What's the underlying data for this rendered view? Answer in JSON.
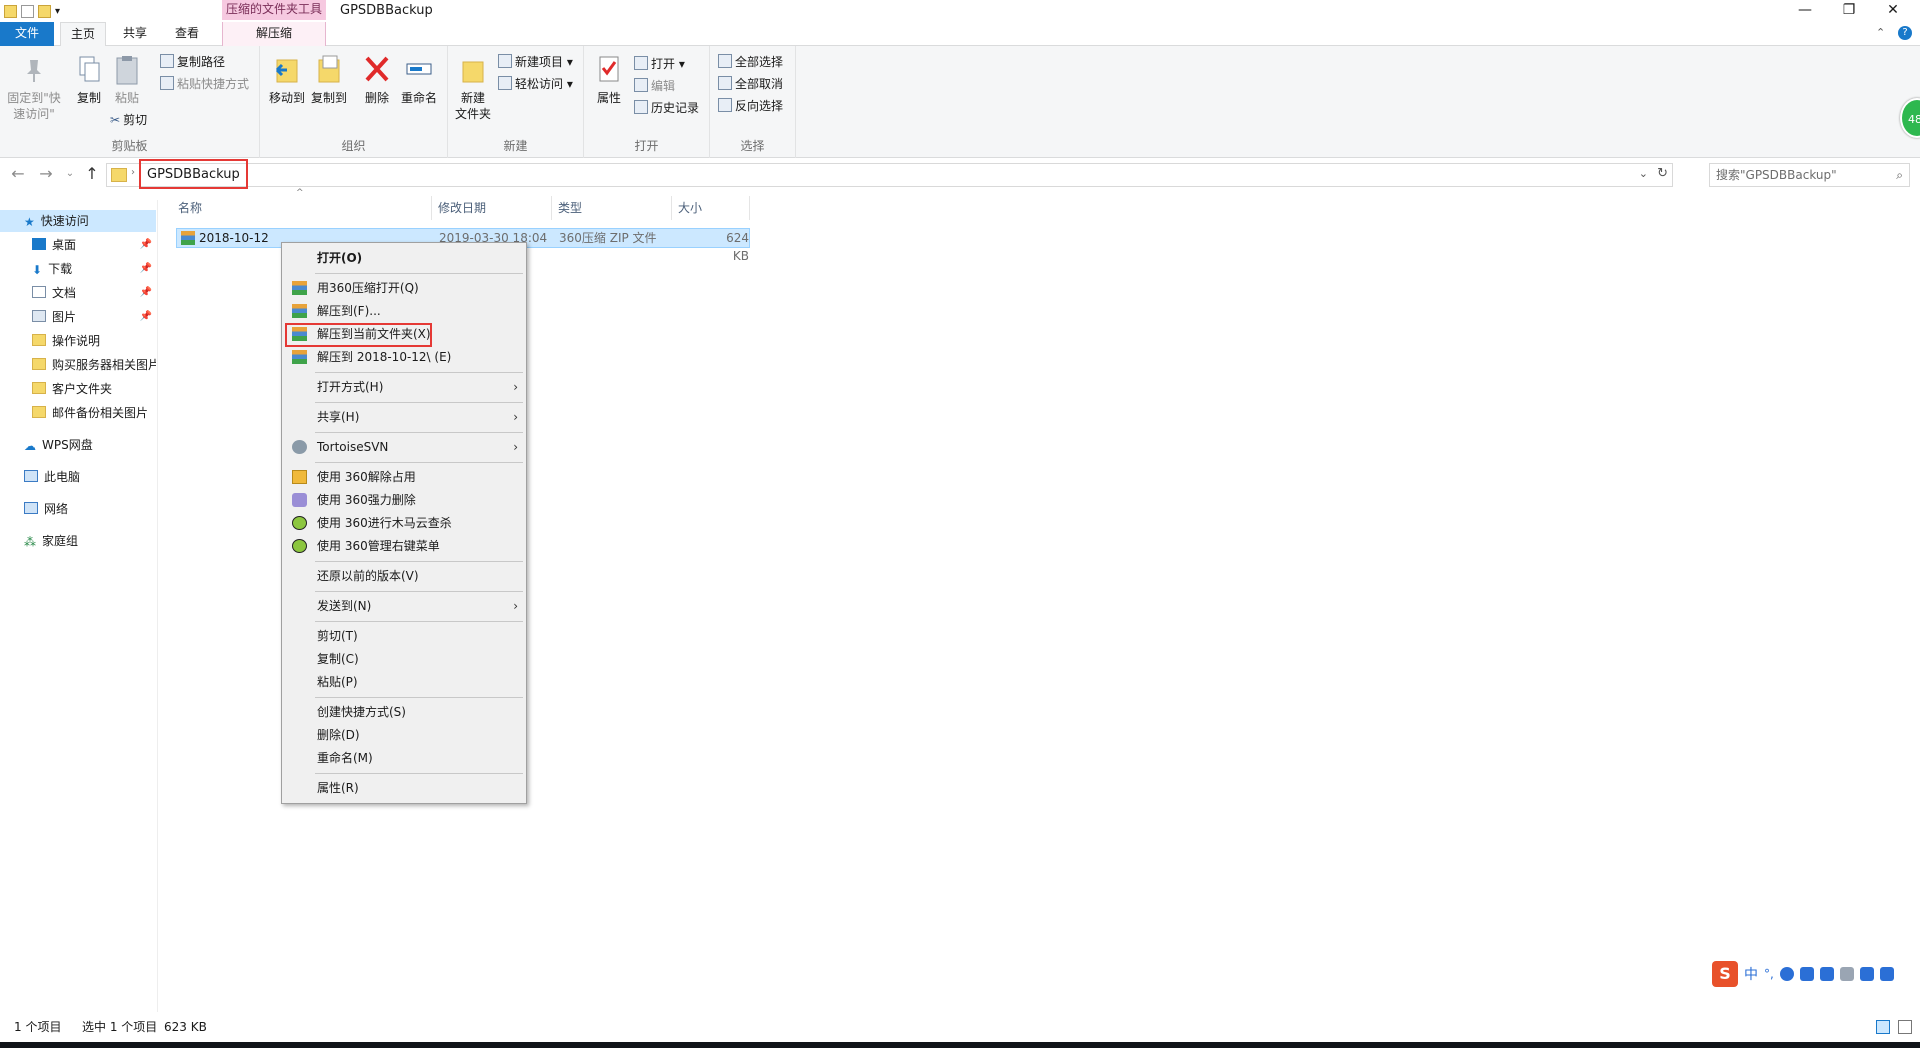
{
  "window": {
    "title": "GPSDBBackup",
    "context_tab_group": "压缩的文件夹工具",
    "controls": {
      "minimize": "—",
      "restore": "❐",
      "close": "✕"
    }
  },
  "tabs": {
    "file": "文件",
    "home": "主页",
    "share": "共享",
    "view": "查看",
    "unzip": "解压缩"
  },
  "ribbon": {
    "clipboard": {
      "label": "剪贴板",
      "pin": "固定到\"快速访问\"",
      "copy": "复制",
      "paste": "粘贴",
      "copy_path": "复制路径",
      "paste_shortcut": "粘贴快捷方式",
      "cut": "剪切"
    },
    "organize": {
      "label": "组织",
      "move_to": "移动到",
      "copy_to": "复制到",
      "delete": "删除",
      "rename": "重命名"
    },
    "new": {
      "label": "新建",
      "new_item": "新建项目 ▾",
      "easy_access": "轻松访问 ▾",
      "new_folder": "新建\n文件夹"
    },
    "open": {
      "label": "打开",
      "properties": "属性",
      "open": "打开 ▾",
      "edit": "编辑",
      "history": "历史记录"
    },
    "select": {
      "label": "选择",
      "select_all": "全部选择",
      "select_none": "全部取消",
      "invert": "反向选择"
    }
  },
  "address": {
    "crumb": "GPSDBBackup",
    "search_placeholder": "搜索\"GPSDBBackup\""
  },
  "navpane": {
    "quick_access": "快速访问",
    "items": [
      "桌面",
      "下载",
      "文档",
      "图片",
      "操作说明",
      "购买服务器相关图片",
      "客户文件夹",
      "邮件备份相关图片"
    ],
    "wps": "WPS网盘",
    "this_pc": "此电脑",
    "network": "网络",
    "homegroup": "家庭组"
  },
  "columns": {
    "name": "名称",
    "modified": "修改日期",
    "type": "类型",
    "size": "大小"
  },
  "files": [
    {
      "name": "2018-10-12",
      "modified": "2019-03-30 18:04",
      "type": "360压缩 ZIP 文件",
      "size": "624 KB"
    }
  ],
  "context_menu": {
    "open": "打开(O)",
    "open_360": "用360压缩打开(Q)",
    "extract_to": "解压到(F)...",
    "extract_here": "解压到当前文件夹(X)",
    "extract_folder": "解压到 2018-10-12\\ (E)",
    "open_with": "打开方式(H)",
    "share": "共享(H)",
    "svn": "TortoiseSVN",
    "unlock_360": "使用 360解除占用",
    "force_delete_360": "使用 360强力删除",
    "scan_360": "使用 360进行木马云查杀",
    "manage_360": "使用 360管理右键菜单",
    "restore_versions": "还原以前的版本(V)",
    "send_to": "发送到(N)",
    "cut": "剪切(T)",
    "copy": "复制(C)",
    "paste": "粘贴(P)",
    "create_shortcut": "创建快捷方式(S)",
    "delete": "删除(D)",
    "rename": "重命名(M)",
    "properties": "属性(R)"
  },
  "status": {
    "count": "1 个项目",
    "selected": "选中 1 个项目",
    "size": "623 KB"
  },
  "ime": {
    "lang": "中"
  },
  "badge": "48",
  "colors": {
    "accent": "#1979ca",
    "highlight_box": "#e53935",
    "selection": "#cce8ff",
    "context_tab": "#f6c9e0"
  }
}
